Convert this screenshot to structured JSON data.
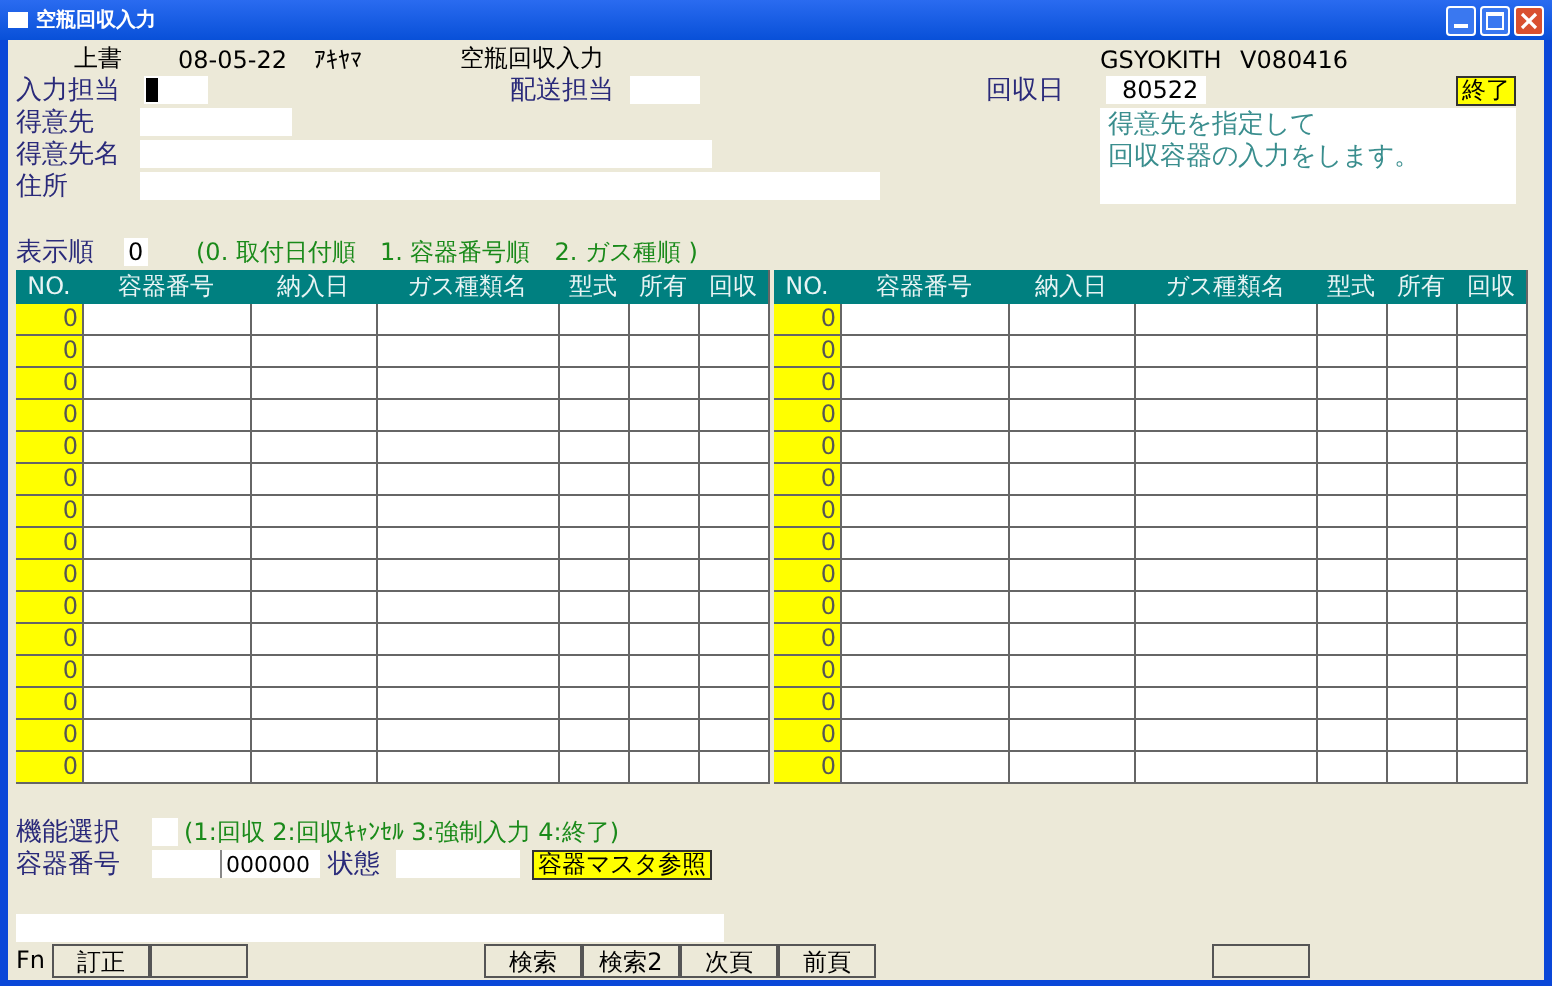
{
  "window": {
    "title": "空瓶回収入力"
  },
  "header": {
    "mode": "上書",
    "date": "08-05-22",
    "user": "ｱｷﾔﾏ",
    "screen_title": "空瓶回収入力",
    "program": "GSYOKITH",
    "version": "V080416"
  },
  "form": {
    "input_staff": {
      "label": "入力担当",
      "cursor": true
    },
    "delivery_staff": {
      "label": "配送担当"
    },
    "collection_date": {
      "label": "回収日",
      "value": "80522"
    },
    "exit_button": "終了",
    "customer": {
      "label": "得意先"
    },
    "customer_name": {
      "label": "得意先名"
    },
    "address": {
      "label": "住所"
    },
    "message": [
      "得意先を指定して",
      "回収容器の入力をします。"
    ],
    "sort_order": {
      "label": "表示順",
      "value": "0",
      "hint": "(0. 取付日付順　1. 容器番号順　2. ガス種順 )"
    }
  },
  "grids": [
    {
      "columns": [
        "NO.",
        "容器番号",
        "納入日",
        "ガス種類名",
        "型式",
        "所有",
        "回収"
      ],
      "rows": [
        "0",
        "0",
        "0",
        "0",
        "0",
        "0",
        "0",
        "0",
        "0",
        "0",
        "0",
        "0",
        "0",
        "0",
        "0"
      ]
    },
    {
      "columns": [
        "NO.",
        "容器番号",
        "納入日",
        "ガス種類名",
        "型式",
        "所有",
        "回収"
      ],
      "rows": [
        "0",
        "0",
        "0",
        "0",
        "0",
        "0",
        "0",
        "0",
        "0",
        "0",
        "0",
        "0",
        "0",
        "0",
        "0"
      ]
    }
  ],
  "function_select": {
    "label": "機能選択",
    "hint": "(1:回収 2:回収ｷｬﾝｾﾙ 3:強制入力 4:終了)"
  },
  "container": {
    "label": "容器番号",
    "value": "000000",
    "status_label": "状態",
    "master_button": "容器マスタ参照"
  },
  "fn_bar": {
    "label": "Fn",
    "keys": [
      {
        "kind": "key",
        "label": "訂正"
      },
      {
        "kind": "blank"
      },
      {
        "kind": "gap"
      },
      {
        "kind": "key",
        "label": "検索"
      },
      {
        "kind": "key",
        "label": "検索2"
      },
      {
        "kind": "key",
        "label": "次頁"
      },
      {
        "kind": "key",
        "label": "前頁"
      },
      {
        "kind": "gap2"
      },
      {
        "kind": "blank"
      }
    ]
  }
}
